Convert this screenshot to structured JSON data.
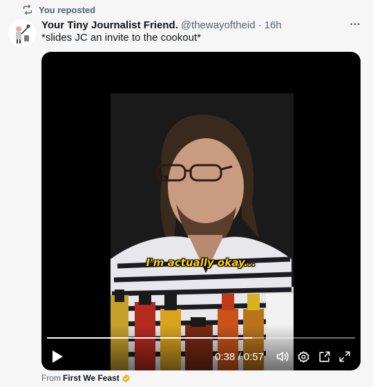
{
  "repost": {
    "label": "You reposted"
  },
  "tweet": {
    "author_name": "Your Tiny Journalist Friend.",
    "author_handle": "@thewayoftheid",
    "dot": "·",
    "time": "16h",
    "text": "*slides JC an invite to the cookout*"
  },
  "video": {
    "caption": "I'm actually okay...",
    "current_time": "0:38",
    "separator": " / ",
    "duration": "0:57",
    "progress_fraction": 0.667
  },
  "source": {
    "prefix": "From",
    "name": "First We Feast"
  },
  "colors": {
    "muted": "#536471",
    "caption": "#ffd400",
    "verified_badge": "#e2b719"
  },
  "icons": [
    "repost-icon",
    "more-icon",
    "play-icon",
    "volume-icon",
    "settings-icon",
    "pip-icon",
    "fullscreen-icon",
    "verified-badge-icon"
  ]
}
